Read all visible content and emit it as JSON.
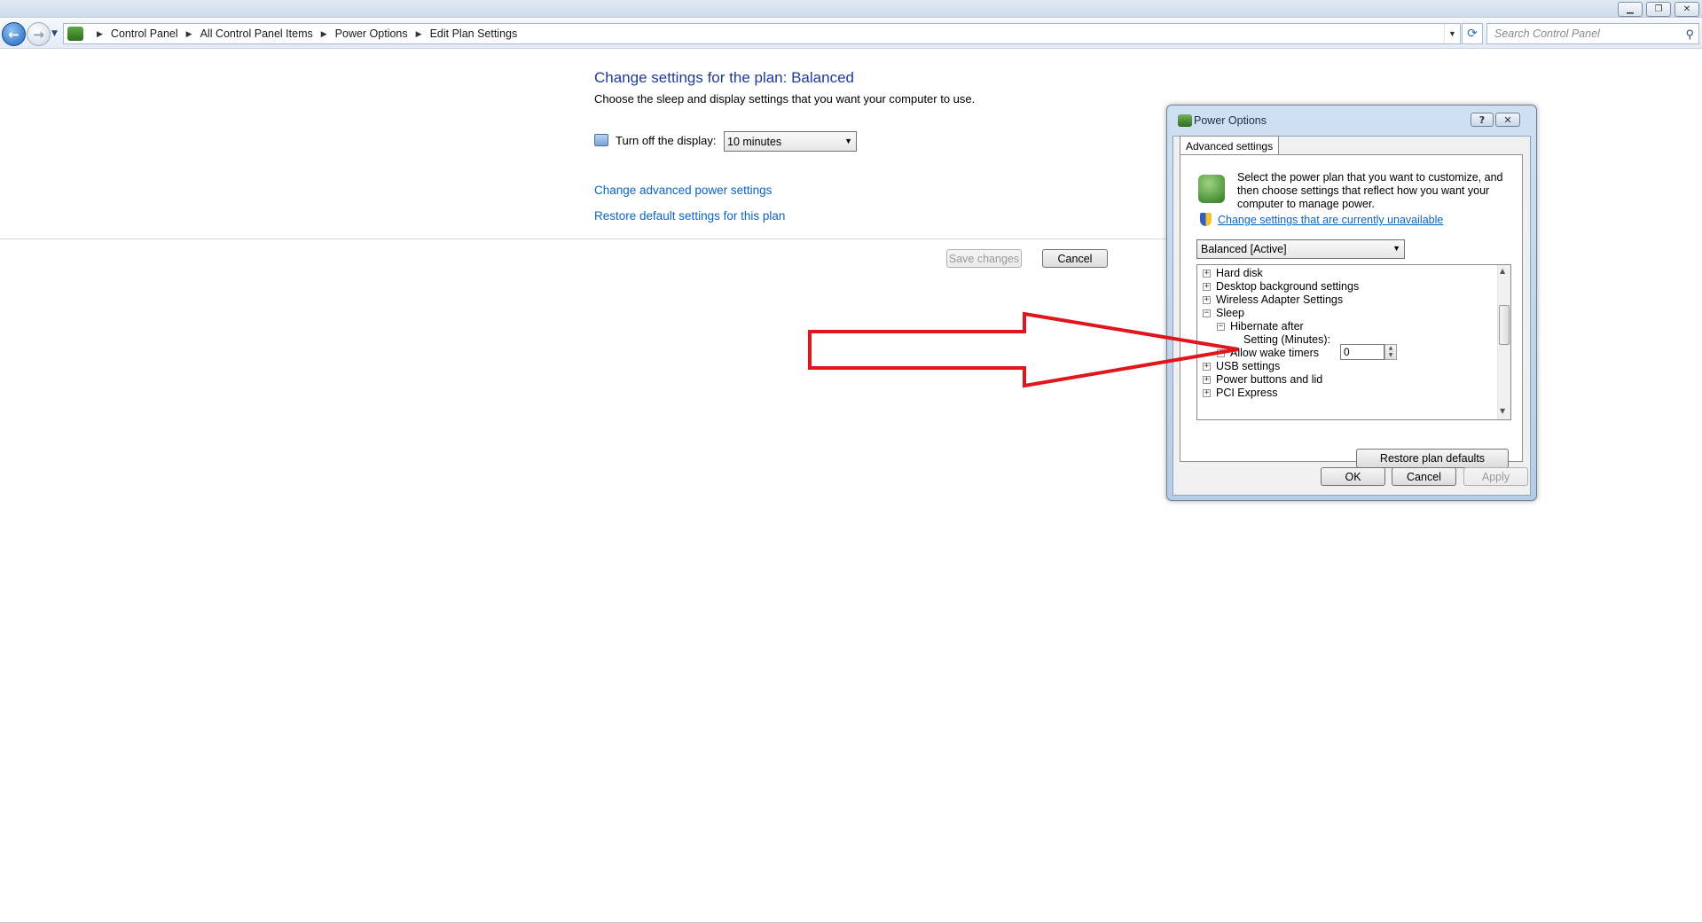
{
  "breadcrumb": {
    "items": [
      "Control Panel",
      "All Control Panel Items",
      "Power Options",
      "Edit Plan Settings"
    ]
  },
  "search": {
    "placeholder": "Search Control Panel"
  },
  "main": {
    "heading": "Change settings for the plan: Balanced",
    "subtitle": "Choose the sleep and display settings that you want your computer to use.",
    "display_label": "Turn off the display:",
    "display_value": "10 minutes",
    "advanced_link": "Change advanced power settings",
    "restore_link": "Restore default settings for this plan",
    "save_label": "Save changes",
    "cancel_label": "Cancel"
  },
  "dialog": {
    "title": "Power Options",
    "help": "?",
    "close": "✕",
    "tab": "Advanced settings",
    "description": "Select the power plan that you want to customize, and then choose settings that reflect how you want your computer to manage power.",
    "unavailable_link": "Change settings that are currently unavailable",
    "plan_value": "Balanced [Active]",
    "tree": [
      {
        "label": "Hard disk",
        "sign": "+"
      },
      {
        "label": "Desktop background settings",
        "sign": "+"
      },
      {
        "label": "Wireless Adapter Settings",
        "sign": "+"
      },
      {
        "label": "Sleep",
        "sign": "−"
      },
      {
        "label": "Hibernate after",
        "sign": "−"
      },
      {
        "label": "Setting (Minutes):",
        "sign": ""
      },
      {
        "label": "Allow wake timers",
        "sign": "+"
      },
      {
        "label": "USB settings",
        "sign": "+"
      },
      {
        "label": "Power buttons and lid",
        "sign": "+"
      },
      {
        "label": "PCI Express",
        "sign": "+"
      }
    ],
    "minutes_value": "0",
    "restore_label": "Restore plan defaults",
    "ok_label": "OK",
    "cancel_label": "Cancel",
    "apply_label": "Apply"
  },
  "colors": {
    "link": "#0b64c6",
    "heading": "#1f3b97",
    "arrow": "#e0161c"
  },
  "icons": [
    "back-arrow-icon",
    "forward-arrow-icon",
    "control-panel-icon",
    "refresh-icon",
    "search-icon",
    "display-icon",
    "power-plan-icon",
    "uac-shield-icon",
    "help-icon",
    "close-icon"
  ]
}
